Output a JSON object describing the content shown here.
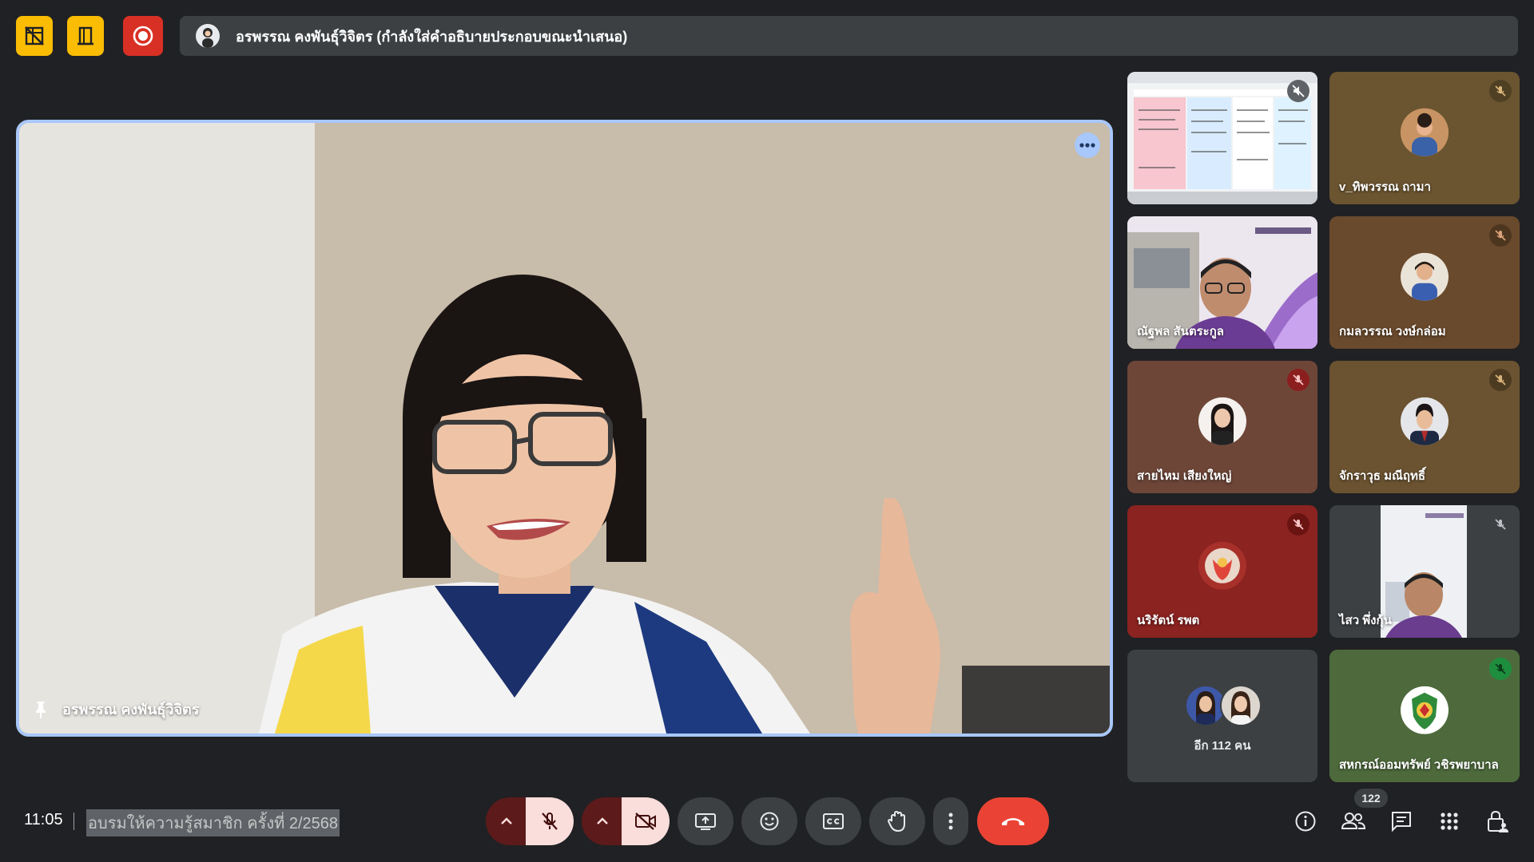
{
  "top_bar": {
    "buttons": [
      {
        "icon": "no-camera-grid-icon",
        "color": "#fbbc04"
      },
      {
        "icon": "door-exit-icon",
        "color": "#fbbc04"
      },
      {
        "icon": "record-icon",
        "color": "#d93025"
      }
    ],
    "presenter_banner": "อรพรรณ คงพันธุ์วิจิตร (กำลังใส่คำอธิบายประกอบขณะนำเสนอ)"
  },
  "main_tile": {
    "name": "อรพรรณ คงพันธุ์วิจิตร",
    "pinned": true,
    "border_color": "#a8c7fa"
  },
  "side_tiles": [
    {
      "name": "",
      "type": "screen-share",
      "muted": true
    },
    {
      "name": "v_ทิพวรรณ ถามา",
      "type": "avatar",
      "muted": true,
      "bg": "#6b5531"
    },
    {
      "name": "ณัฐพล สันตระกูล",
      "type": "video",
      "muted": false
    },
    {
      "name": "กมลวรรณ วงษ์กล่อม",
      "type": "avatar",
      "muted": true,
      "bg": "#6a4a2c"
    },
    {
      "name": "สายไหม เสียงใหญ่",
      "type": "avatar",
      "muted": true,
      "bg": "#6e4638"
    },
    {
      "name": "จักราวุธ มณีฤทธิ์",
      "type": "avatar",
      "muted": true,
      "bg": "#6b5331"
    },
    {
      "name": "นริรัตน์ รพต",
      "type": "avatar",
      "muted": true,
      "bg": "#8b2320"
    },
    {
      "name": "ไสว พึ่งกุ้น",
      "type": "video",
      "muted": true
    },
    {
      "name": "อีก 112 คน",
      "type": "more"
    },
    {
      "name": "สหกรณ์ออมทรัพย์ วชิรพยาบาล",
      "type": "avatar",
      "muted": true,
      "bg": "#4e6a3c"
    }
  ],
  "bottom_bar": {
    "time": "11:05",
    "meeting_title": "อบรมให้ความรู้สมาชิก ครั้งที่ 2/2568",
    "participant_count": "122",
    "controls": [
      "mic-off",
      "camera-off",
      "present",
      "emoji",
      "captions",
      "raise-hand",
      "more",
      "end-call"
    ],
    "right_icons": [
      "info",
      "people",
      "chat",
      "activities",
      "host-controls"
    ]
  },
  "colors": {
    "background": "#202124",
    "panel": "#3c4043",
    "end_call": "#ea4335",
    "muted_red": "#5c1a1a",
    "accent": "#a8c7fa"
  }
}
